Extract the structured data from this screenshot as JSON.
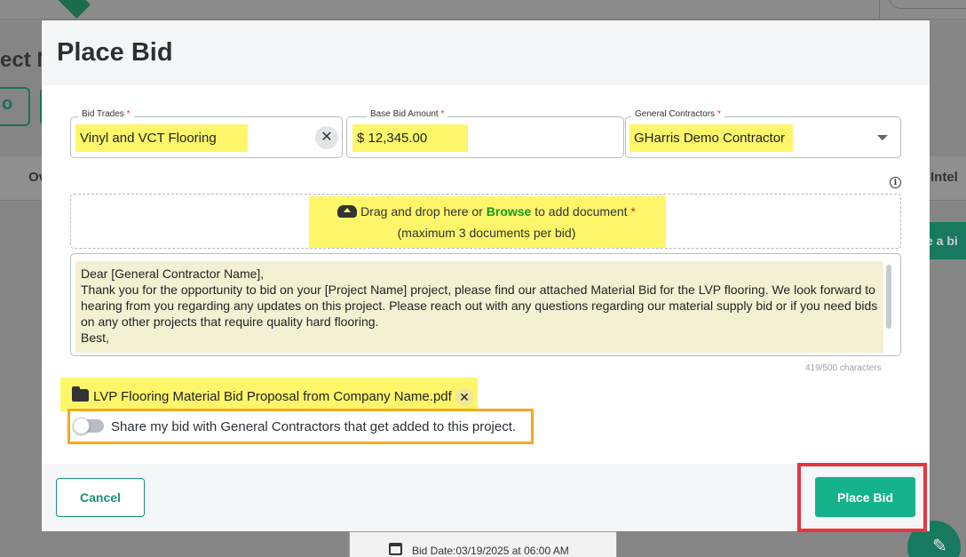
{
  "background": {
    "page_title_fragment": "ect N",
    "button_fragment": "o",
    "tab_left": "Ov",
    "tab_right": "Intel",
    "place_bid_fragment": "e a bi",
    "bid_date": "Bid Date:03/19/2025 at 06:00 AM"
  },
  "modal": {
    "title": "Place Bid",
    "bid_trades": {
      "label": "Bid Trades",
      "required_mark": "*",
      "value": "Vinyl and VCT Flooring",
      "clear_glyph": "✕"
    },
    "base_bid_amount": {
      "label": "Base Bid Amount",
      "required_mark": "*",
      "value": "$ 12,345.00"
    },
    "general_contractors": {
      "label": "General Contractors",
      "required_mark": "*",
      "value": "GHarris Demo Contractor"
    },
    "info_glyph": "i",
    "dropzone": {
      "text_before": "Drag and drop here or",
      "browse_label": "Browse",
      "text_after": "to add document",
      "required_mark": "*",
      "subtext": "(maximum 3 documents per bid)"
    },
    "message": {
      "text": "Dear [General Contractor Name],\nThank you for the opportunity to bid on your [Project Name] project, please find our attached Material Bid for the LVP flooring. We look forward to hearing from you regarding any updates on this project. Please reach out with any questions regarding our material supply bid or if you need bids on any other projects that require quality hard flooring.\nBest,",
      "char_count": "419/500 characters"
    },
    "attachment": {
      "file_name": "LVP Flooring Material Bid Proposal from Company Name.pdf",
      "remove_glyph": "✕"
    },
    "share_toggle": {
      "label": "Share my bid with General Contractors that get added to this project.",
      "enabled": false
    },
    "footer": {
      "cancel_label": "Cancel",
      "place_bid_label": "Place Bid"
    }
  },
  "colors": {
    "accent": "#15b38b",
    "highlight": "#fdf66b",
    "annotation_orange": "#f4a822",
    "annotation_red": "#e8353d",
    "browse_green": "#169a22",
    "required_red": "#e0262f"
  }
}
